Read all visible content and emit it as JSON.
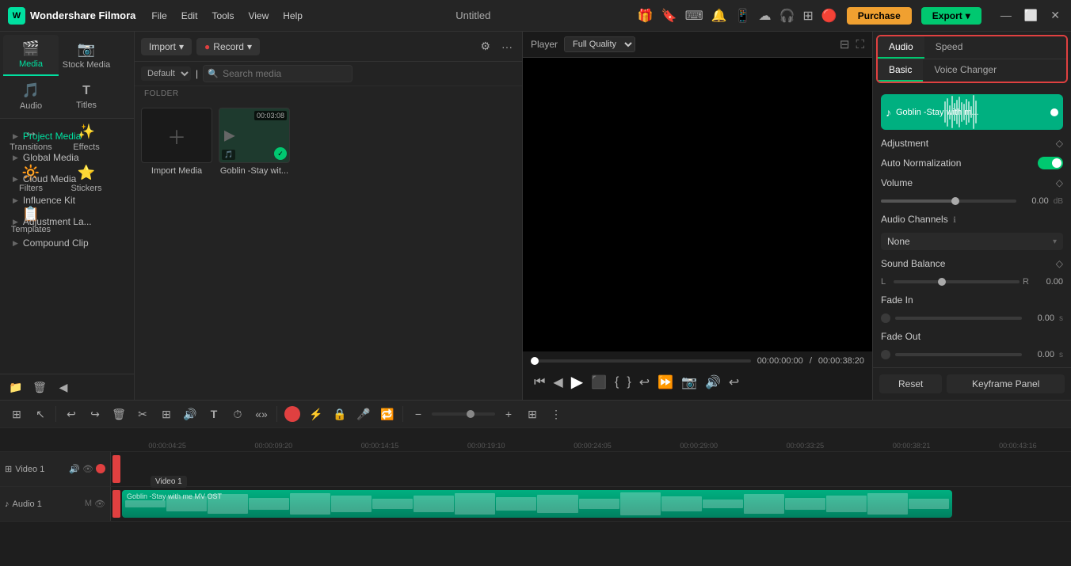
{
  "app": {
    "name": "Wondershare Filmora",
    "title": "Untitled",
    "purchase_label": "Purchase",
    "export_label": "Export"
  },
  "menu": {
    "items": [
      "File",
      "Edit",
      "Tools",
      "View",
      "Help"
    ]
  },
  "nav_tabs": [
    {
      "id": "media",
      "label": "Media",
      "icon": "🎬",
      "active": true
    },
    {
      "id": "stock-media",
      "label": "Stock Media",
      "icon": "📷"
    },
    {
      "id": "audio",
      "label": "Audio",
      "icon": "🎵"
    },
    {
      "id": "titles",
      "label": "Titles",
      "icon": "T"
    },
    {
      "id": "transitions",
      "label": "Transitions",
      "icon": "↔"
    },
    {
      "id": "effects",
      "label": "Effects",
      "icon": "✨"
    },
    {
      "id": "filters",
      "label": "Filters",
      "icon": "🔆"
    },
    {
      "id": "stickers",
      "label": "Stickers",
      "icon": "⭐"
    },
    {
      "id": "templates",
      "label": "Templates",
      "icon": "📋"
    }
  ],
  "sidebar": {
    "items": [
      {
        "label": "Project Media",
        "active": true
      },
      {
        "label": "Global Media"
      },
      {
        "label": "Cloud Media"
      },
      {
        "label": "Influence Kit"
      },
      {
        "label": "Adjustment La..."
      },
      {
        "label": "Compound Clip"
      }
    ]
  },
  "media_panel": {
    "import_label": "Import",
    "record_label": "Record",
    "sort_default": "Default",
    "search_placeholder": "Search media",
    "folder_label": "FOLDER",
    "items": [
      {
        "type": "add",
        "label": "Import Media"
      },
      {
        "type": "video",
        "label": "Goblin -Stay wit...",
        "duration": "00:03:08",
        "has_check": true
      }
    ]
  },
  "player": {
    "label": "Player",
    "quality": "Full Quality",
    "current_time": "00:00:00:00",
    "total_time": "00:00:38:20"
  },
  "right_panel": {
    "tabs": [
      {
        "label": "Audio",
        "active": true
      },
      {
        "label": "Speed"
      }
    ],
    "sub_tabs": [
      {
        "label": "Basic",
        "active": true
      },
      {
        "label": "Voice Changer"
      }
    ],
    "audio_clip": {
      "title": "Goblin -Stay with m...",
      "icon": "♪"
    },
    "adjustment_label": "Adjustment",
    "auto_normalization_label": "Auto Normalization",
    "auto_normalization_on": true,
    "volume_label": "Volume",
    "volume_value": "0.00",
    "volume_unit": "dB",
    "audio_channels_label": "Audio Channels",
    "audio_channels_info": "ℹ",
    "audio_channels_value": "None",
    "sound_balance_label": "Sound Balance",
    "sound_balance_value": "0.00",
    "sound_balance_l": "L",
    "sound_balance_r": "R",
    "fade_in_label": "Fade In",
    "fade_in_value": "0.00",
    "fade_in_unit": "s",
    "fade_out_label": "Fade Out",
    "fade_out_value": "0.00",
    "fade_out_unit": "s",
    "reset_label": "Reset",
    "keyframe_label": "Keyframe Panel"
  },
  "timeline": {
    "ruler_ticks": [
      "00:00:04:25",
      "00:00:09:20",
      "00:00:14:15",
      "00:00:19:10",
      "00:00:24:05",
      "00:00:29:00",
      "00:00:33:25",
      "00:00:38:21",
      "00:00:43:16"
    ],
    "tracks": [
      {
        "type": "video",
        "name": "Video 1",
        "icons": [
          "🔊",
          "👁"
        ]
      },
      {
        "type": "audio",
        "name": "Audio 1",
        "icons": [
          "🔊",
          "M"
        ],
        "clip_label": "Goblin -Stay with me MV OST"
      }
    ],
    "toolbar": {
      "buttons": [
        "↩",
        "↪",
        "🗑",
        "✂",
        "⊞",
        "🔊",
        "T",
        "⏱",
        "«»",
        "🎯",
        "⊡",
        "🔒",
        "🎤",
        "🔁"
      ],
      "zoom_minus": "−",
      "zoom_plus": "+"
    }
  }
}
